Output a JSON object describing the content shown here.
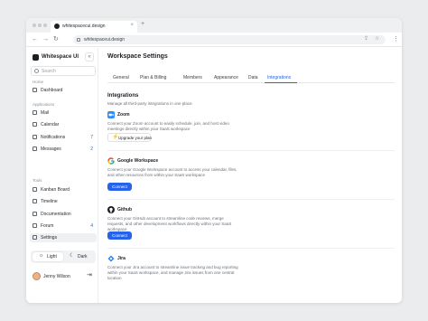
{
  "browser": {
    "tab_title": "whitespacecui.design",
    "url": "whitespaceui.design"
  },
  "sidebar": {
    "brand": "Whitespace UI",
    "search_placeholder": "Search",
    "groups": [
      {
        "label": "Home",
        "items": [
          {
            "label": "Dashboard",
            "icon": "grid-icon"
          }
        ]
      },
      {
        "label": "Applications",
        "items": [
          {
            "label": "Mail",
            "icon": "mail-icon"
          },
          {
            "label": "Calendar",
            "icon": "calendar-icon"
          },
          {
            "label": "Notifications",
            "icon": "bell-icon",
            "count": "7"
          },
          {
            "label": "Messages",
            "icon": "chat-icon",
            "count": "2"
          }
        ]
      },
      {
        "label": "Tools",
        "items": [
          {
            "label": "Kanban Board",
            "icon": "kanban-icon"
          },
          {
            "label": "Timeline",
            "icon": "timeline-icon"
          },
          {
            "label": "Documentation",
            "icon": "document-icon"
          },
          {
            "label": "Forum",
            "icon": "forum-icon",
            "count": "4"
          },
          {
            "label": "Settings",
            "icon": "gear-icon",
            "active": true
          }
        ]
      }
    ],
    "theme": {
      "light": "Light",
      "dark": "Dark",
      "selected": "Light"
    },
    "user": {
      "name": "Jenny Wilson"
    }
  },
  "main": {
    "title": "Workspace Settings",
    "tabs": [
      "General",
      "Plan & Billing",
      "Members",
      "Appearance",
      "Data",
      "Integrations"
    ],
    "active_tab": "Integrations",
    "section_title": "Integrations",
    "section_desc": "Manage all third-party integrations in one place.",
    "integrations": [
      {
        "name": "Zoom",
        "desc": "Connect your Zoom account to easily schedule, join, and host video meetings directly within your SaaS workspace",
        "button": "Upgrade your plan",
        "logo_color": "#2d8cff"
      },
      {
        "name": "Google Workspace",
        "desc": "Connect your Google Workspace account to access your calendar, files, and other resources from within your SaaS workspace",
        "button": "Connect",
        "logo_color": "#ea4335"
      },
      {
        "name": "Github",
        "desc": "Connect your GitHub account to streamline code reviews, merge requests, and other development workflows directly within your SaaS workspace",
        "button": "Connect",
        "logo_color": "#1c1f24"
      },
      {
        "name": "Jira",
        "desc": "Connect your Jira account to streamline issue tracking and bug reporting within your SaaS workspace, and manage Jira issues from one central location",
        "button": "",
        "logo_color": "#2684ff"
      }
    ]
  },
  "colors": {
    "accent": "#2563eb",
    "sidebar_active_bg": "#eef0f2"
  }
}
